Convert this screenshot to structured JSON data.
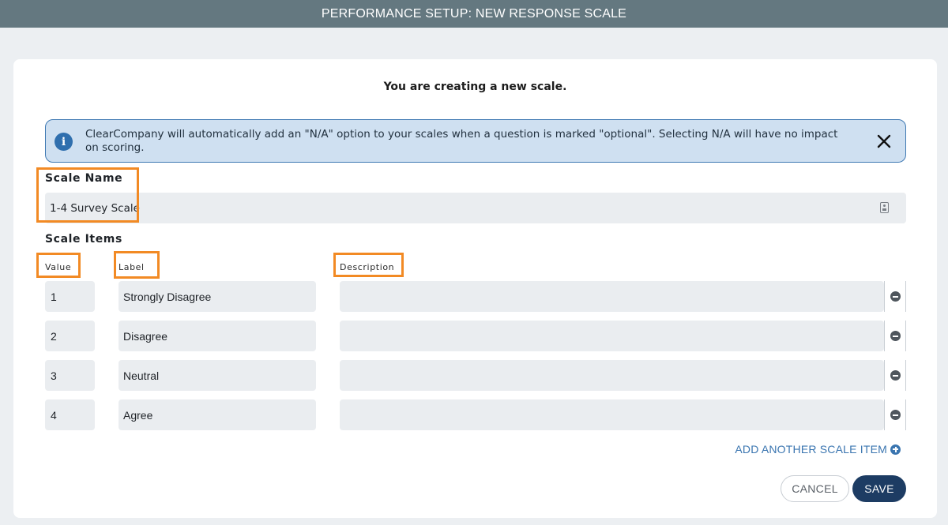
{
  "header": {
    "title": "PERFORMANCE SETUP: NEW RESPONSE SCALE"
  },
  "subtitle": "You are creating a new scale.",
  "info_banner": {
    "icon": "info-icon",
    "text": "ClearCompany will automatically add an \"N/A\" option to your scales when a question is marked \"optional\". Selecting N/A will have no impact on scoring.",
    "close_icon": "close-icon"
  },
  "scale_name": {
    "label": "Scale Name",
    "value": "1-4 Survey Scale"
  },
  "scale_items": {
    "label": "Scale Items",
    "columns": {
      "value": "Value",
      "label": "Label",
      "description": "Description"
    },
    "rows": [
      {
        "value": "1",
        "label": "Strongly Disagree",
        "description": ""
      },
      {
        "value": "2",
        "label": "Disagree",
        "description": ""
      },
      {
        "value": "3",
        "label": "Neutral",
        "description": ""
      },
      {
        "value": "4",
        "label": "Agree",
        "description": ""
      }
    ]
  },
  "add_item_label": "ADD ANOTHER SCALE ITEM",
  "buttons": {
    "cancel": "CANCEL",
    "save": "SAVE"
  },
  "colors": {
    "header_bg": "#647880",
    "highlight": "#f28a24",
    "banner_bg": "#cfe0f1",
    "link": "#3a75b0",
    "primary_button": "#1d3c63"
  }
}
